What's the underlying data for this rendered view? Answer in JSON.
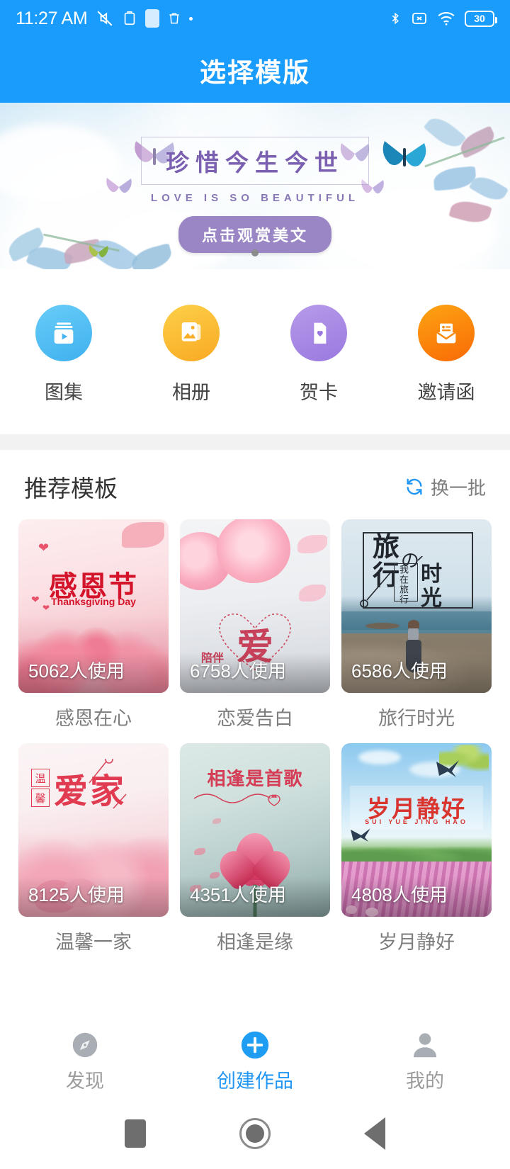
{
  "statusbar": {
    "time": "11:27 AM",
    "battery_level": "30",
    "left_icons": [
      "mute-icon",
      "clipboard-icon",
      "app-icon",
      "trash-icon",
      "more-dot-icon"
    ],
    "right_icons": [
      "bluetooth-icon",
      "no-sim-icon",
      "wifi-icon",
      "battery-icon"
    ]
  },
  "appbar": {
    "title": "选择模版"
  },
  "banner": {
    "main_text": "珍惜今生今世",
    "sub_text": "LOVE IS SO BEAUTIFUL",
    "button_label": "点击观赏美文",
    "dot_count": 1,
    "accent": "#9a86c4"
  },
  "categories": [
    {
      "label": "图集",
      "icon": "slideshow-icon",
      "color": "#5ec1f5"
    },
    {
      "label": "相册",
      "icon": "photos-icon",
      "color": "#fbbd2b"
    },
    {
      "label": "贺卡",
      "icon": "greeting-card-icon",
      "color": "#a586e0"
    },
    {
      "label": "邀请函",
      "icon": "envelope-icon",
      "color": "#fb8a0b"
    }
  ],
  "section": {
    "title": "推荐模板",
    "refresh_label": "换一批",
    "refresh_icon": "refresh-icon",
    "refresh_color": "#2196f3"
  },
  "templates": [
    {
      "name": "感恩在心",
      "count": "5062人使用",
      "art_title": "感恩节",
      "art_sub": "Thanksgiving Day"
    },
    {
      "name": "恋爱告白",
      "count": "6758人使用",
      "art_title": "爱",
      "art_sub": "陪伴"
    },
    {
      "name": "旅行时光",
      "count": "6586人使用",
      "art_title": "旅行の时光",
      "art_sub": "我在旅行"
    },
    {
      "name": "温馨一家",
      "count": "8125人使用",
      "art_title": "爱家",
      "art_sub": "温馨"
    },
    {
      "name": "相逢是缘",
      "count": "4351人使用",
      "art_title": "相逢是首歌",
      "art_sub": ""
    },
    {
      "name": "岁月静好",
      "count": "4808人使用",
      "art_title": "岁月静好",
      "art_sub": "SUI YUE JING HAO"
    }
  ],
  "tabbar": [
    {
      "label": "发现",
      "icon": "compass-icon",
      "active": false
    },
    {
      "label": "创建作品",
      "icon": "plus-icon",
      "active": true
    },
    {
      "label": "我的",
      "icon": "person-icon",
      "active": false
    }
  ],
  "androidnav": {
    "recents": "square-recents-icon",
    "home": "circle-home-icon",
    "back": "triangle-back-icon"
  }
}
